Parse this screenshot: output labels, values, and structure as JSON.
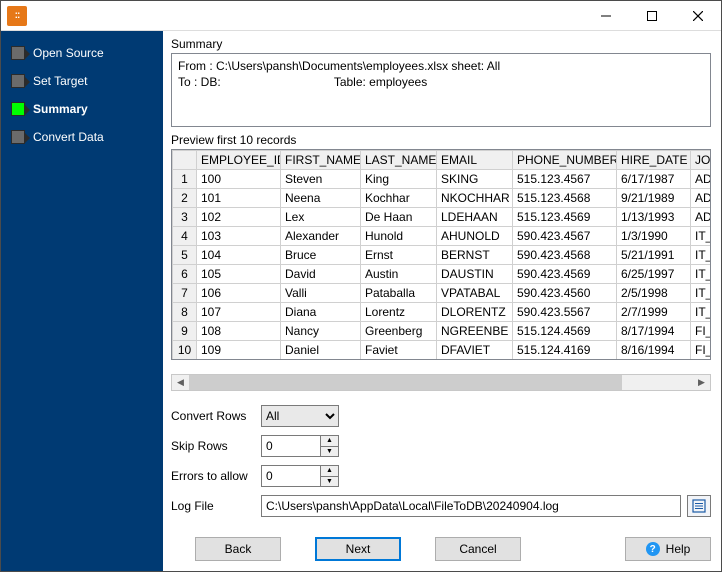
{
  "titlebar": {
    "app_initials": "::"
  },
  "sidebar": {
    "steps": [
      {
        "label": "Open Source"
      },
      {
        "label": "Set Target"
      },
      {
        "label": "Summary"
      },
      {
        "label": "Convert Data"
      }
    ]
  },
  "summary": {
    "heading": "Summary",
    "text": "From : C:\\Users\\pansh\\Documents\\employees.xlsx sheet: All\nTo : DB:                                  Table: employees"
  },
  "preview": {
    "heading": "Preview first 10 records",
    "columns": [
      "EMPLOYEE_ID",
      "FIRST_NAME",
      "LAST_NAME",
      "EMAIL",
      "PHONE_NUMBER",
      "HIRE_DATE",
      "JOB"
    ],
    "rows": [
      [
        "100",
        "Steven",
        "King",
        "SKING",
        "515.123.4567",
        "6/17/1987",
        "AD_"
      ],
      [
        "101",
        "Neena",
        "Kochhar",
        "NKOCHHAR",
        "515.123.4568",
        "9/21/1989",
        "AD_"
      ],
      [
        "102",
        "Lex",
        "De Haan",
        "LDEHAAN",
        "515.123.4569",
        "1/13/1993",
        "AD_"
      ],
      [
        "103",
        "Alexander",
        "Hunold",
        "AHUNOLD",
        "590.423.4567",
        "1/3/1990",
        "IT_P"
      ],
      [
        "104",
        "Bruce",
        "Ernst",
        "BERNST",
        "590.423.4568",
        "5/21/1991",
        "IT_P"
      ],
      [
        "105",
        "David",
        "Austin",
        "DAUSTIN",
        "590.423.4569",
        "6/25/1997",
        "IT_P"
      ],
      [
        "106",
        "Valli",
        "Pataballa",
        "VPATABAL",
        "590.423.4560",
        "2/5/1998",
        "IT_P"
      ],
      [
        "107",
        "Diana",
        "Lorentz",
        "DLORENTZ",
        "590.423.5567",
        "2/7/1999",
        "IT_P"
      ],
      [
        "108",
        "Nancy",
        "Greenberg",
        "NGREENBE",
        "515.124.4569",
        "8/17/1994",
        "FI_M"
      ],
      [
        "109",
        "Daniel",
        "Faviet",
        "DFAVIET",
        "515.124.4169",
        "8/16/1994",
        "FI_A"
      ]
    ]
  },
  "form": {
    "convert_label": "Convert Rows",
    "convert_value": "All",
    "skip_label": "Skip Rows",
    "skip_value": "0",
    "errors_label": "Errors to allow",
    "errors_value": "0",
    "logfile_label": "Log File",
    "logfile_value": "C:\\Users\\pansh\\AppData\\Local\\FileToDB\\20240904.log"
  },
  "buttons": {
    "back": "Back",
    "next": "Next",
    "cancel": "Cancel",
    "help": "Help"
  }
}
